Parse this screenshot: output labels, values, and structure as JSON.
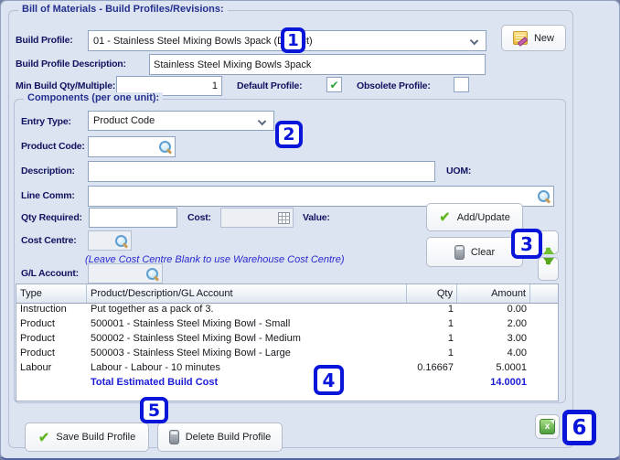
{
  "window": {
    "legend": "Bill of Materials - Build Profiles/Revisions:"
  },
  "header": {
    "build_profile_label": "Build Profile:",
    "build_profile_value": "01 - Stainless Steel Mixing Bowls 3pack (Default)",
    "new_button": "New",
    "description_label": "Build Profile Description:",
    "description_value": "Stainless Steel Mixing Bowls 3pack",
    "min_qty_label": "Min Build Qty/Multiple:",
    "min_qty_value": "1",
    "default_profile_label": "Default Profile:",
    "default_profile_checked": true,
    "obsolete_profile_label": "Obsolete Profile:",
    "obsolete_profile_checked": false
  },
  "components": {
    "legend": "Components (per one unit):",
    "entry_type_label": "Entry Type:",
    "entry_type_value": "Product Code",
    "product_code_label": "Product Code:",
    "description_label": "Description:",
    "uom_label": "UOM:",
    "line_comm_label": "Line Comm:",
    "qty_required_label": "Qty Required:",
    "cost_label": "Cost:",
    "value_label": "Value:",
    "cost_centre_label": "Cost Centre:",
    "cost_centre_hint": "(Leave Cost Centre Blank to use Warehouse Cost Centre)",
    "gl_account_label": "G/L Account:",
    "add_update_button": "Add/Update",
    "clear_button": "Clear"
  },
  "table": {
    "columns": [
      "Type",
      "Product/Description/GL Account",
      "Qty",
      "Amount"
    ],
    "rows": [
      {
        "type": "Instruction",
        "description": "Put together as a pack of 3.",
        "qty": "1",
        "amount": "0.00"
      },
      {
        "type": "Product",
        "description": "500001 - Stainless Steel Mixing Bowl - Small",
        "qty": "1",
        "amount": "2.00"
      },
      {
        "type": "Product",
        "description": "500002 - Stainless Steel Mixing Bowl - Medium",
        "qty": "1",
        "amount": "3.00"
      },
      {
        "type": "Product",
        "description": "500003 - Stainless Steel Mixing Bowl - Large",
        "qty": "1",
        "amount": "4.00"
      },
      {
        "type": "Labour",
        "description": "Labour - Labour - 10 minutes",
        "qty": "0.16667",
        "amount": "5.0001"
      }
    ],
    "total_label": "Total Estimated Build Cost",
    "total_amount": "14.0001"
  },
  "footer": {
    "save_button": "Save Build Profile",
    "delete_button": "Delete Build Profile"
  },
  "callouts": [
    "1",
    "2",
    "3",
    "4",
    "5",
    "6"
  ],
  "colors": {
    "callout_blue": "#0a15da",
    "panel_background": "#dce3f1",
    "label_navy": "#101460",
    "hint_blue": "#2a2ad0",
    "total_blue": "#1b1bd8",
    "check_green": "#5db41d",
    "arrow_green": "#6fbf2e"
  }
}
